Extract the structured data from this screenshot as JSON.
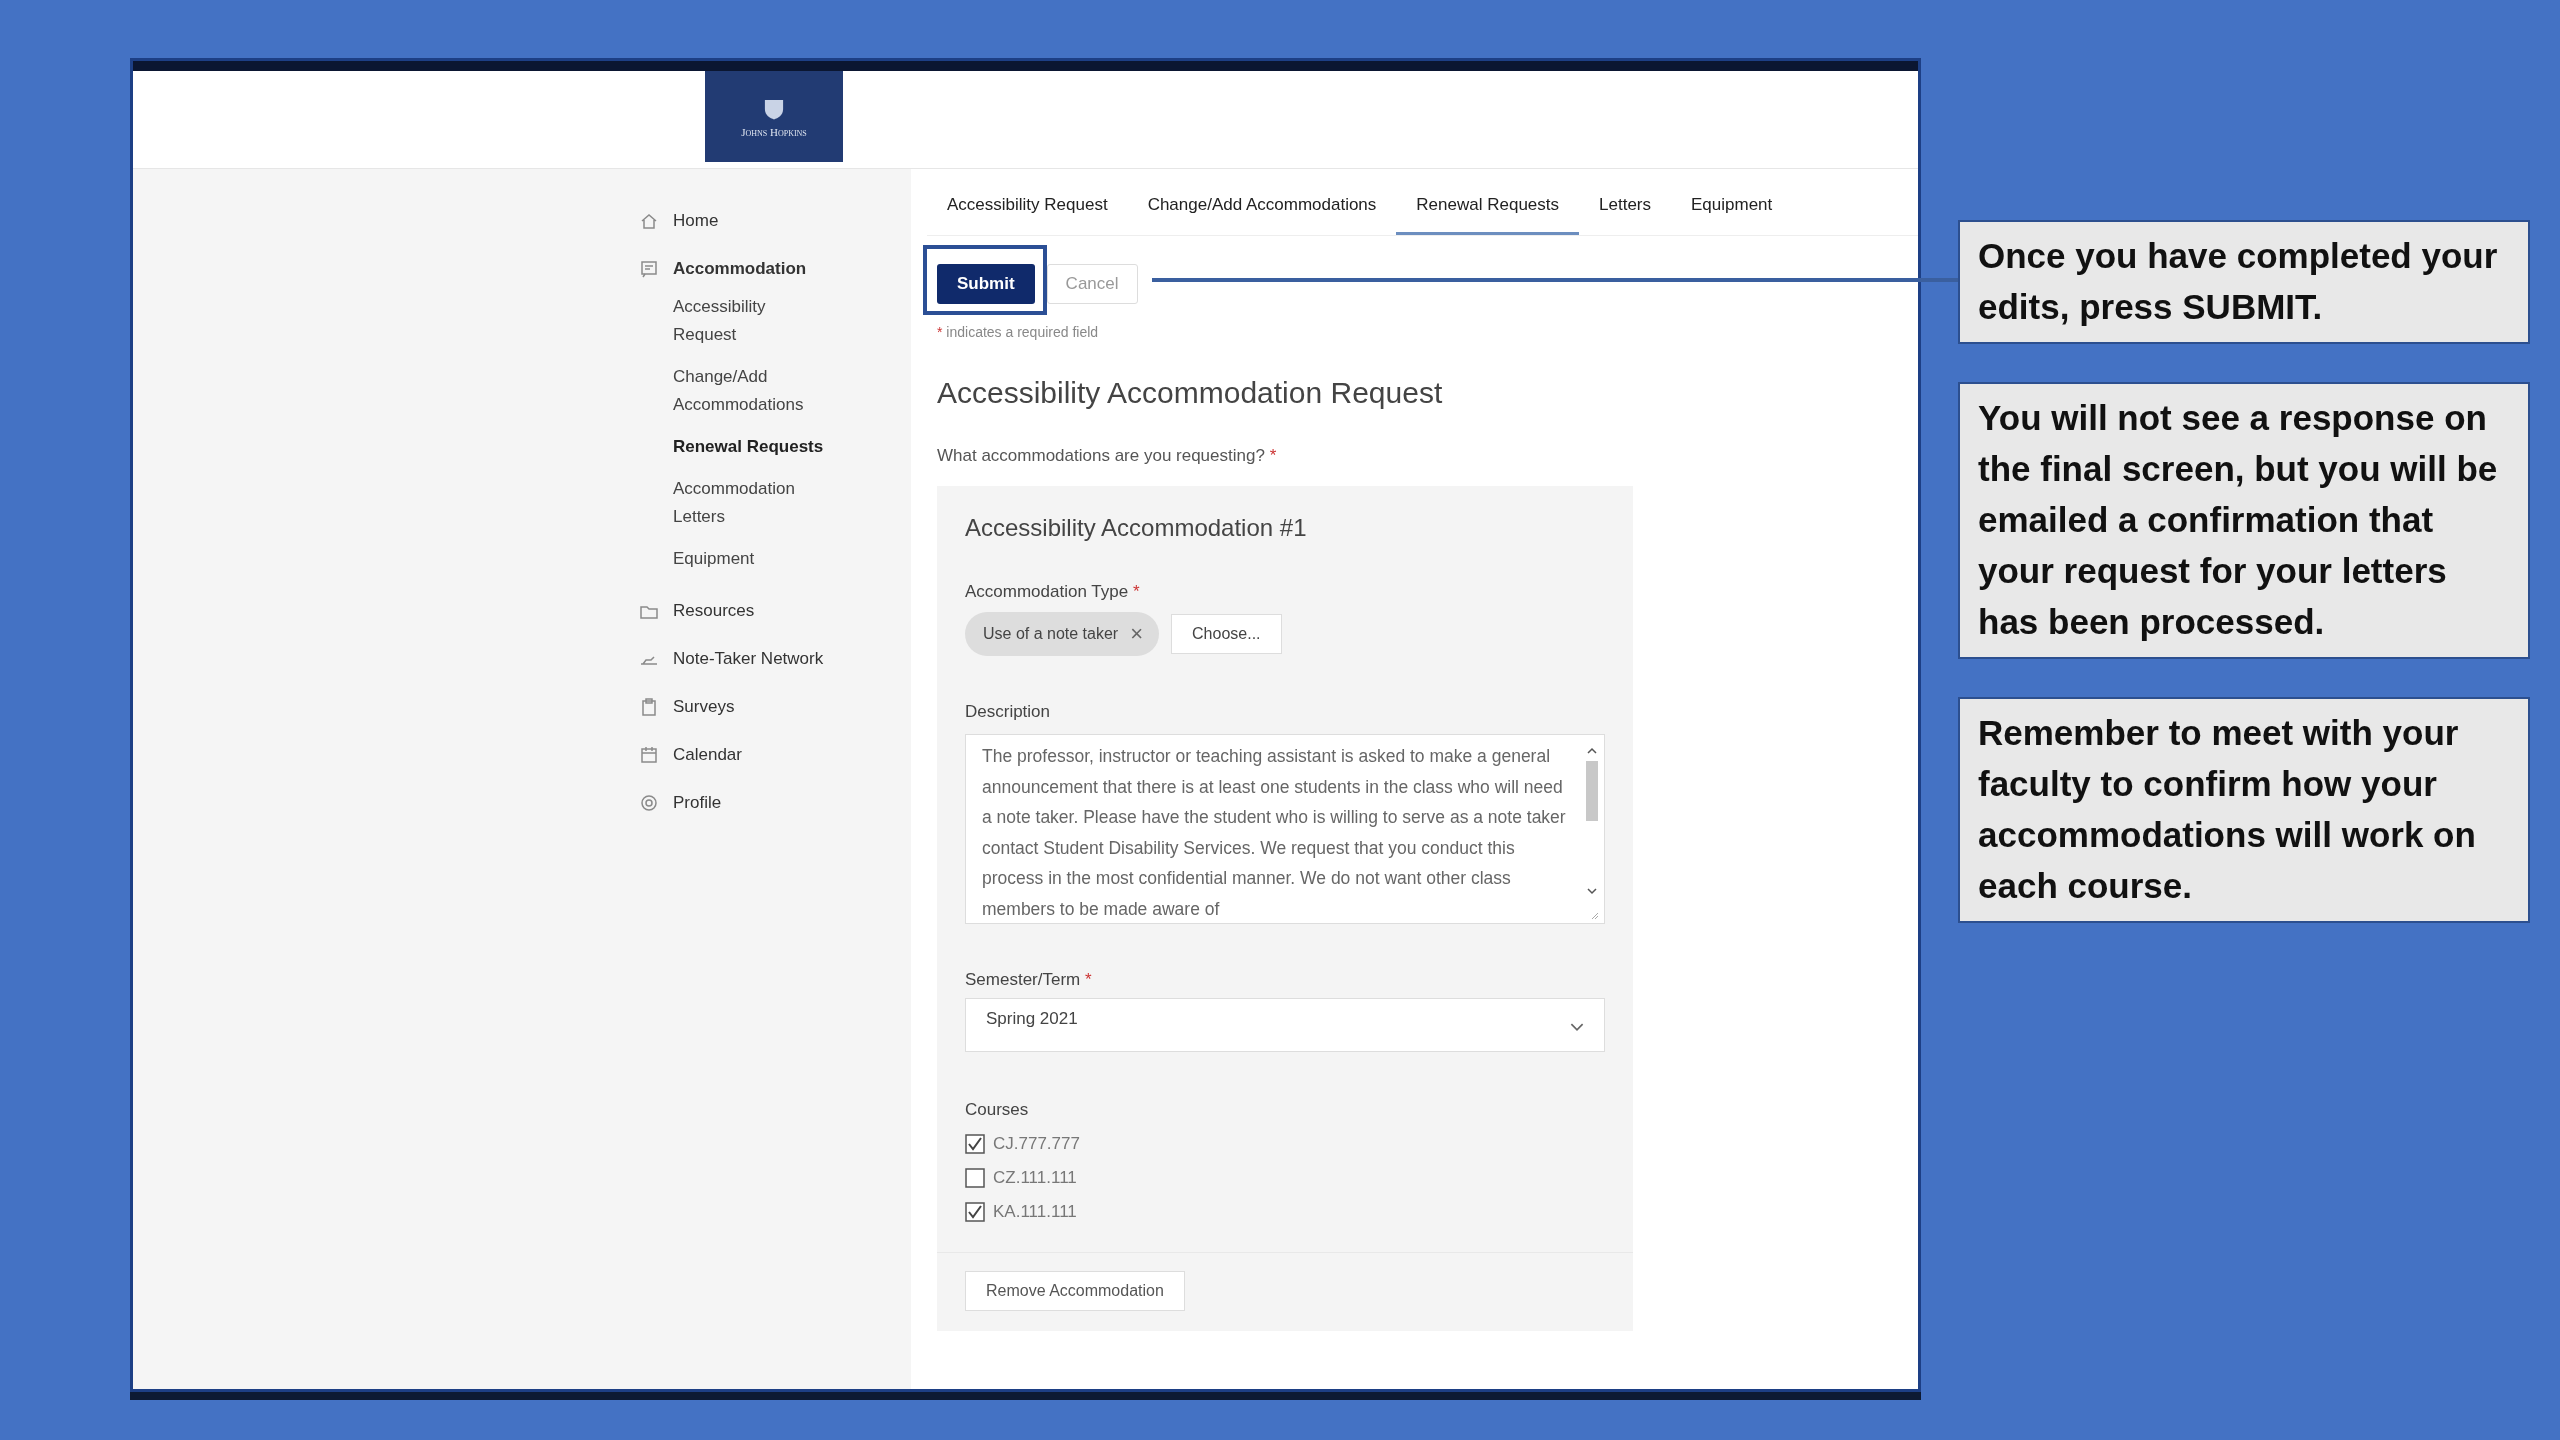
{
  "logo": {
    "text": "Johns Hopkins"
  },
  "sidebar": {
    "items": [
      {
        "label": "Home",
        "selected": false,
        "expanded": false
      },
      {
        "label": "Accommodation",
        "selected": false,
        "expanded": true,
        "children": [
          {
            "label": "Accessibility Request",
            "selected": false
          },
          {
            "label": "Change/Add Accommodations",
            "selected": false
          },
          {
            "label": "Renewal Requests",
            "selected": true
          },
          {
            "label": "Accommodation Letters",
            "selected": false
          },
          {
            "label": "Equipment",
            "selected": false
          }
        ]
      },
      {
        "label": "Resources",
        "selected": false,
        "expanded": false
      },
      {
        "label": "Note-Taker Network",
        "selected": false,
        "expanded": false
      },
      {
        "label": "Surveys",
        "selected": false,
        "expanded": false
      },
      {
        "label": "Calendar",
        "selected": false,
        "expanded": false
      },
      {
        "label": "Profile",
        "selected": false,
        "expanded": false
      }
    ]
  },
  "tabs": [
    {
      "label": "Accessibility Request",
      "selected": false
    },
    {
      "label": "Change/Add Accommodations",
      "selected": false
    },
    {
      "label": "Renewal Requests",
      "selected": true
    },
    {
      "label": "Letters",
      "selected": false
    },
    {
      "label": "Equipment",
      "selected": false
    }
  ],
  "actions": {
    "submit": "Submit",
    "cancel": "Cancel"
  },
  "required_note": {
    "mark": "*",
    "text": "indicates a required field"
  },
  "form": {
    "title": "Accessibility Accommodation Request",
    "question": {
      "label": "What accommodations are you requesting?",
      "required_mark": "*"
    },
    "card": {
      "title": "Accessibility Accommodation #1",
      "type_field": {
        "label": "Accommodation Type",
        "required_mark": "*",
        "chip": "Use of a note taker",
        "chip_remove": "×",
        "choose": "Choose..."
      },
      "description": {
        "label": "Description",
        "value": "The professor, instructor or teaching assistant is asked to make a general announcement that there is at least one students in the class who will need a note taker. Please have the student who is willing to serve as a note taker contact Student Disability Services. We request that you conduct this process in the most confidential manner. We do not want other class members to be made aware of"
      },
      "term": {
        "label": "Semester/Term",
        "required_mark": "*",
        "value": "Spring 2021"
      },
      "courses": {
        "label": "Courses",
        "items": [
          {
            "code": "CJ.777.777",
            "checked": true
          },
          {
            "code": "CZ.111.111",
            "checked": false
          },
          {
            "code": "KA.111.111",
            "checked": true
          }
        ]
      },
      "remove": "Remove Accommodation"
    }
  },
  "callouts": [
    "Once you have completed your edits, press SUBMIT.",
    "You will not see a response on the final screen, but you will be emailed a confirmation that your request for your letters has been processed.",
    "Remember to meet with your faculty to confirm how your accommodations will work on each course."
  ]
}
